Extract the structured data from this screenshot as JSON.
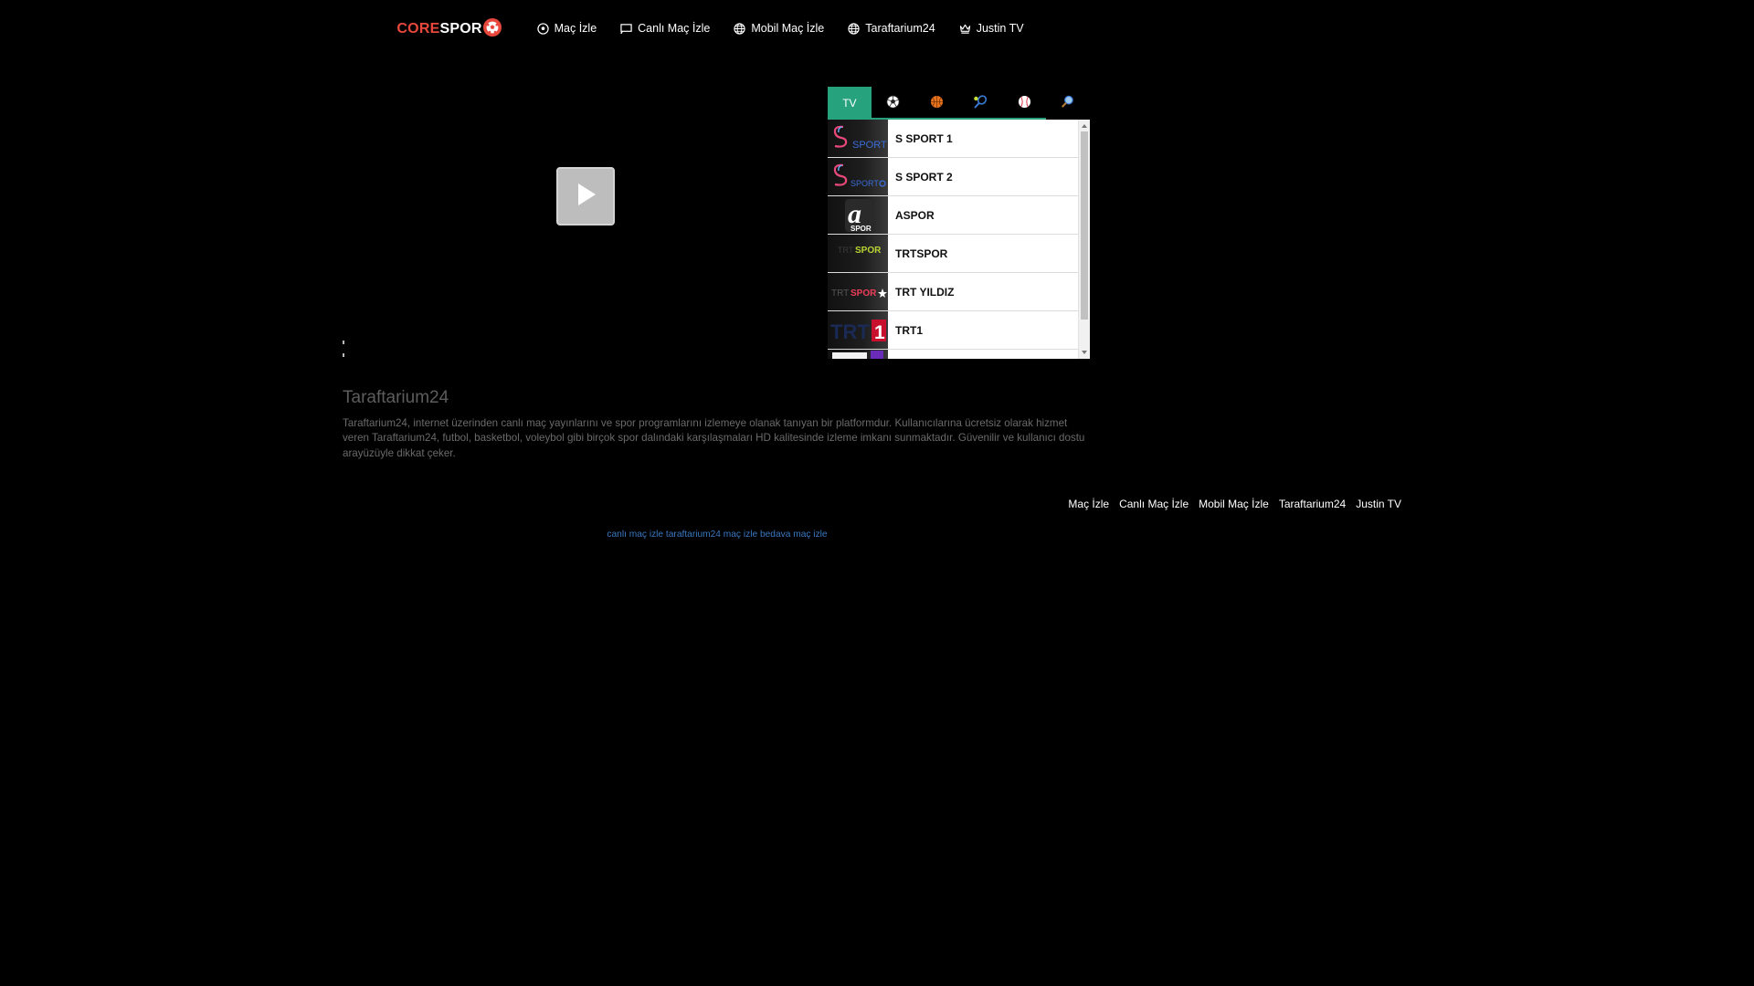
{
  "brand": {
    "part1": "CORE",
    "part2": "SPOR"
  },
  "nav": [
    {
      "label": "Maç İzle",
      "icon": "soccer-ball-icon"
    },
    {
      "label": "Canlı Maç İzle",
      "icon": "cast-icon"
    },
    {
      "label": "Mobil Maç İzle",
      "icon": "globe-icon"
    },
    {
      "label": "Taraftarium24",
      "icon": "globe-icon"
    },
    {
      "label": "Justin TV",
      "icon": "crown-icon"
    }
  ],
  "tabs": {
    "tv_label": "TV",
    "active": "TV",
    "accent_color": "#26a37c",
    "icons": [
      "soccer-ball-icon",
      "basketball-icon",
      "tennis-icon",
      "baseball-icon",
      "search-icon"
    ]
  },
  "channels": [
    {
      "name": "S SPORT 1",
      "logo": "s-sport-logo"
    },
    {
      "name": "S SPORT 2",
      "logo": "s-sport-plus-logo"
    },
    {
      "name": "ASPOR",
      "logo": "a-spor-logo"
    },
    {
      "name": "TRTSPOR",
      "logo": "trt-spor-logo"
    },
    {
      "name": "TRT YILDIZ",
      "logo": "trt-spor-yildiz-logo"
    },
    {
      "name": "TRT1",
      "logo": "trt-1-logo"
    },
    {
      "name": "",
      "logo": "partial-logo"
    }
  ],
  "about": {
    "title": "Taraftarium24",
    "text": "Taraftarium24, internet üzerinden canlı maç yayınlarını ve spor programlarını izlemeye olanak tanıyan bir platformdur. Kullanıcılarına ücretsiz olarak hizmet veren Taraftarium24, futbol, basketbol, voleybol gibi birçok spor dalındaki karşılaşmaları HD kalitesinde izleme imkanı sunmaktadır. Güvenilir ve kullanıcı dostu arayüzüyle dikkat çeker."
  },
  "footer": {
    "links": [
      "Maç İzle",
      "Canlı Maç İzle",
      "Mobil Maç İzle",
      "Taraftarium24",
      "Justin TV"
    ],
    "tagline": "canlı maç izle taraftarium24 maç izle bedava maç izle"
  }
}
